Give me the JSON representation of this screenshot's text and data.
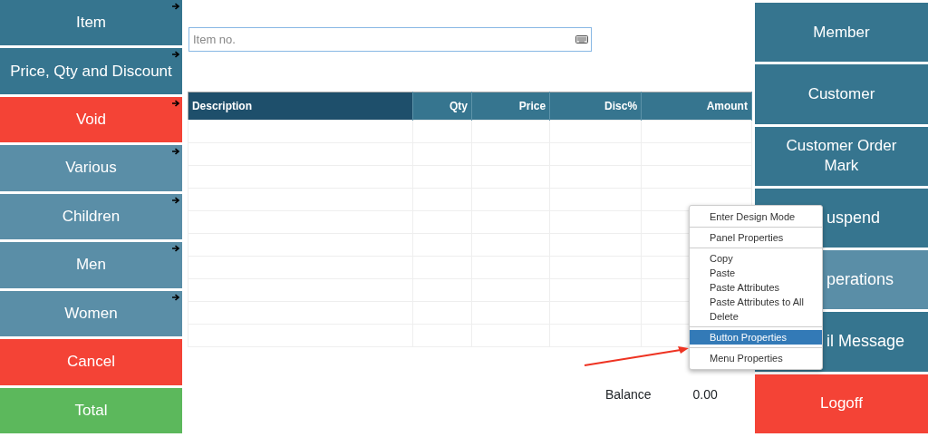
{
  "left_buttons": [
    {
      "label": "Item",
      "kind": "dark",
      "submenu": true
    },
    {
      "label": "Price, Qty and Discount",
      "kind": "dark",
      "submenu": true
    },
    {
      "label": "Void",
      "kind": "red",
      "submenu": true
    },
    {
      "label": "Various",
      "kind": "light",
      "submenu": true
    },
    {
      "label": "Children",
      "kind": "light",
      "submenu": true
    },
    {
      "label": "Men",
      "kind": "light",
      "submenu": true
    },
    {
      "label": "Women",
      "kind": "light",
      "submenu": true
    },
    {
      "label": "Cancel",
      "kind": "red",
      "submenu": false
    },
    {
      "label": "Total",
      "kind": "green",
      "submenu": false
    }
  ],
  "item_field": {
    "placeholder": "Item no."
  },
  "table": {
    "columns": [
      {
        "label": "Description",
        "kind": "primary"
      },
      {
        "label": "Qty",
        "kind": "numeric"
      },
      {
        "label": "Price",
        "kind": "numeric"
      },
      {
        "label": "Disc%",
        "kind": "numeric"
      },
      {
        "label": "Amount",
        "kind": "numeric"
      }
    ]
  },
  "balance": {
    "label": "Balance",
    "value": "0.00"
  },
  "right_buttons": [
    {
      "label": "Member",
      "kind": "dark",
      "covered": false
    },
    {
      "label": "Customer",
      "kind": "dark",
      "covered": false
    },
    {
      "label": "Customer Order Mark",
      "kind": "dark",
      "covered": false
    },
    {
      "label": "uspend",
      "kind": "dark",
      "covered": true
    },
    {
      "label": "perations",
      "kind": "light",
      "covered": true
    },
    {
      "label": "il Message",
      "kind": "dark",
      "covered": true
    },
    {
      "label": "Logoff",
      "kind": "red",
      "covered": false
    }
  ],
  "context_menu": {
    "groups": [
      [
        {
          "label": "Enter Design Mode",
          "selected": false
        }
      ],
      [
        {
          "label": "Panel Properties",
          "selected": false
        }
      ],
      [
        {
          "label": "Copy",
          "selected": false
        },
        {
          "label": "Paste",
          "selected": false
        },
        {
          "label": "Paste Attributes",
          "selected": false
        },
        {
          "label": "Paste Attributes to All",
          "selected": false
        },
        {
          "label": "Delete",
          "selected": false
        }
      ],
      [
        {
          "label": "Button Properties",
          "selected": true
        }
      ],
      [
        {
          "label": "Menu Properties",
          "selected": false
        }
      ]
    ]
  }
}
